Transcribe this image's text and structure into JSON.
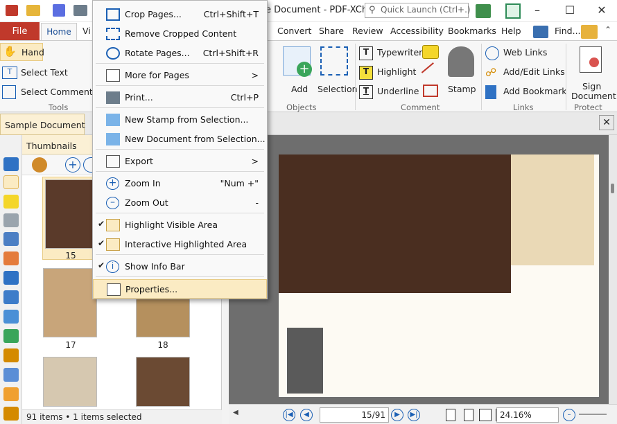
{
  "window": {
    "title": "e Document - PDF-XCha...",
    "search_placeholder": "Quick Launch (Ctrl+.)"
  },
  "tabs": {
    "file": "File",
    "home": "Home",
    "vi": "Vi",
    "convert": "Convert",
    "share": "Share",
    "review": "Review",
    "accessibility": "Accessibility",
    "bookmarks": "Bookmarks",
    "help": "Help",
    "find": "Find..."
  },
  "ribbon": {
    "tools": {
      "hand": "Hand",
      "select_text": "Select Text",
      "select_comments": "Select Comments",
      "group": "Tools"
    },
    "objects": {
      "add": "Add",
      "selection": "Selection",
      "group": "Objects"
    },
    "comment": {
      "typewriter": "Typewriter",
      "highlight": "Highlight",
      "underline": "Underline",
      "stamp": "Stamp",
      "group": "Comment"
    },
    "links": {
      "web_links": "Web Links",
      "add_edit_links": "Add/Edit Links",
      "add_bookmark": "Add Bookmark",
      "group": "Links"
    },
    "protect": {
      "sign_line1": "Sign",
      "sign_line2": "Document",
      "group": "Protect"
    }
  },
  "doc_tab": {
    "label": "Sample Document"
  },
  "thumbnails": {
    "header": "Thumbnails",
    "pages": [
      "15",
      "17",
      "18"
    ],
    "status": "91 items • 1 items selected"
  },
  "navigation": {
    "page_field": "15",
    "page_total": "/91",
    "zoom": "24.16%"
  },
  "menu": {
    "items": [
      {
        "label": "Crop Pages...",
        "shortcut": "Ctrl+Shift+T"
      },
      {
        "label": "Remove Cropped Content",
        "shortcut": ""
      },
      {
        "label": "Rotate Pages...",
        "shortcut": "Ctrl+Shift+R"
      },
      {
        "label": "More for Pages",
        "shortcut": ">"
      },
      {
        "label": "Print...",
        "shortcut": "Ctrl+P"
      },
      {
        "label": "New Stamp from Selection...",
        "shortcut": ""
      },
      {
        "label": "New Document from Selection...",
        "shortcut": ""
      },
      {
        "label": "Export",
        "shortcut": ">"
      },
      {
        "label": "Zoom In",
        "shortcut": "\"Num +\""
      },
      {
        "label": "Zoom Out",
        "shortcut": "-"
      },
      {
        "label": "Highlight Visible Area",
        "shortcut": ""
      },
      {
        "label": "Interactive Highlighted Area",
        "shortcut": ""
      },
      {
        "label": "Show Info Bar",
        "shortcut": ""
      },
      {
        "label": "Properties...",
        "shortcut": ""
      }
    ]
  },
  "colors": {
    "file_tab": "#c0392b",
    "accent": "#1a5fb4",
    "selection": "#fbebc3"
  }
}
